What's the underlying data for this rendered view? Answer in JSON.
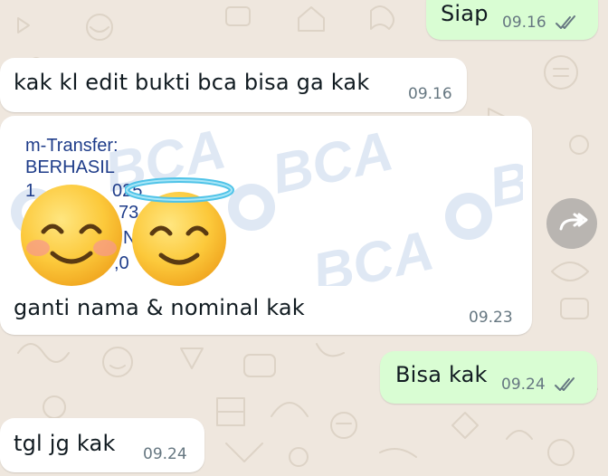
{
  "messages": [
    {
      "direction": "outgoing",
      "text": "Siap",
      "time": "09.16",
      "status": "read"
    },
    {
      "direction": "incoming",
      "text": "kak kl edit bukti bca bisa ga kak",
      "time": "09.16"
    },
    {
      "direction": "incoming",
      "type": "image",
      "image": {
        "receipt_lines": [
          "m-Transfer:",
          "BERHASIL",
          "1",
          "025",
          "73",
          "N",
          ",0"
        ],
        "watermark": "BCA",
        "stickers": [
          "smiling-face-with-smiling-eyes",
          "smiling-face-with-halo"
        ]
      },
      "caption": "ganti nama & nominal kak",
      "time": "09.23"
    },
    {
      "direction": "outgoing",
      "text": "Bisa kak",
      "time": "09.24",
      "status": "read"
    },
    {
      "direction": "incoming",
      "text": "tgl jg kak",
      "time": "09.24"
    }
  ],
  "colors": {
    "background": "#efe7de",
    "incoming_bubble": "#ffffff",
    "outgoing_bubble": "#d9fdd3",
    "read_ticks": "#667781",
    "receipt_text": "#1f3d8a"
  },
  "forward_button": {
    "icon": "forward-icon"
  }
}
